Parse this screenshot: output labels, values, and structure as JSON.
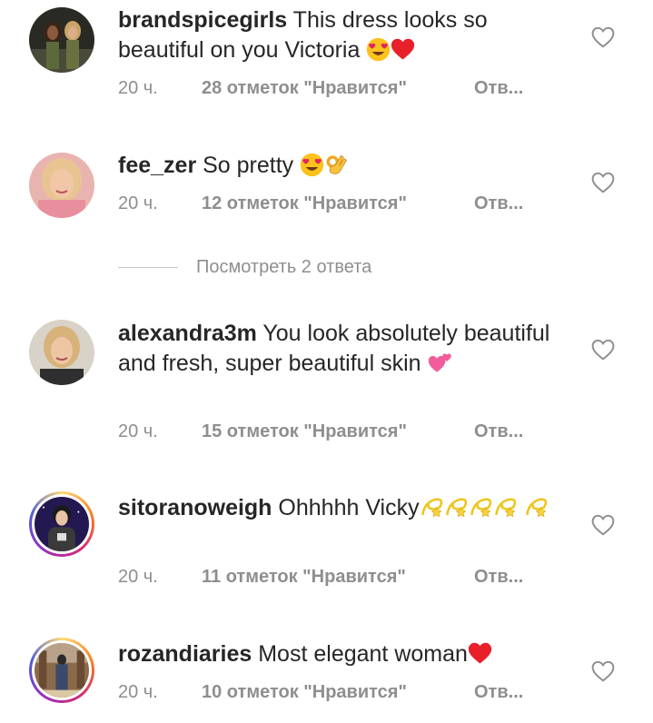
{
  "comments": [
    {
      "username": "brandspicegirls",
      "text": "This dress looks so beautiful on you Victoria",
      "time": "20 ч.",
      "likes": "28 отметок \"Нравится\"",
      "reply": "Отв..."
    },
    {
      "username": "fee_zer",
      "text": "So pretty",
      "time": "20 ч.",
      "likes": "12 отметок \"Нравится\"",
      "reply": "Отв..."
    },
    {
      "username": "alexandra3m",
      "text": "You look absolutely beautiful and fresh, super beautiful skin",
      "time": "20 ч.",
      "likes": "15 отметок \"Нравится\"",
      "reply": "Отв..."
    },
    {
      "username": "sitoranoweigh",
      "text": "Ohhhhh Vicky",
      "time": "20 ч.",
      "likes": "11 отметок \"Нравится\"",
      "reply": "Отв..."
    },
    {
      "username": "rozandiaries",
      "text": "Most elegant woman",
      "time": "20 ч.",
      "likes": "10 отметок \"Нравится\"",
      "reply": "Отв..."
    }
  ],
  "view_replies": "Посмотреть 2 ответа",
  "colors": {
    "text": "#262626",
    "secondary": "#8e8e8e",
    "heart_outline": "#8e8e8e"
  },
  "icons": [
    "heart-outline-icon",
    "heart-eyes-emoji",
    "red-heart-emoji",
    "ok-hand-emoji",
    "two-hearts-emoji",
    "dizzy-emoji"
  ]
}
